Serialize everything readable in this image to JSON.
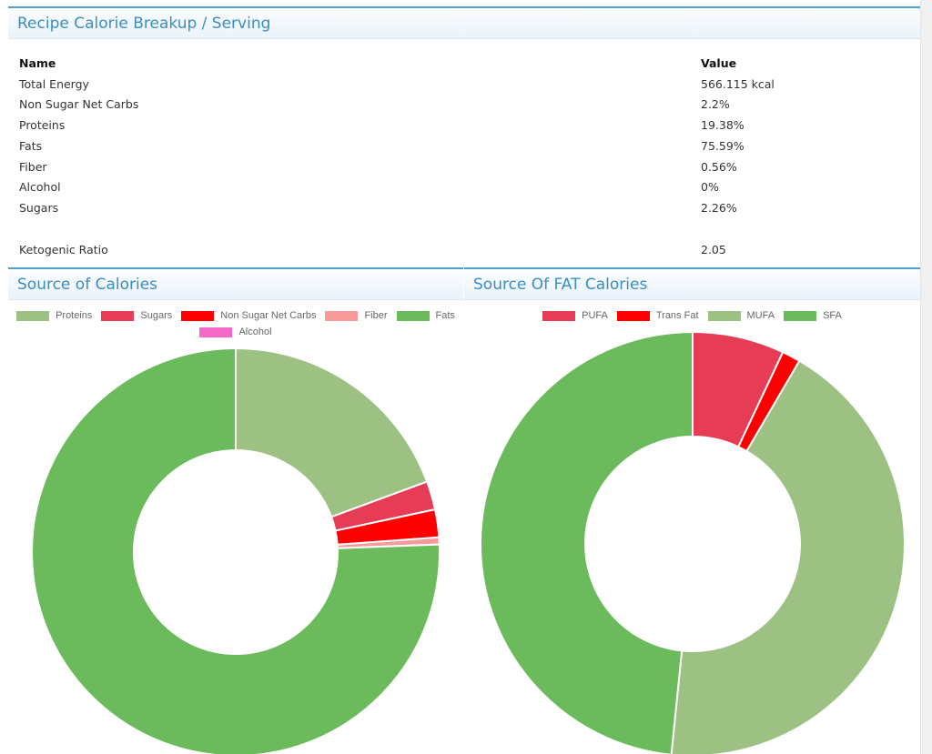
{
  "breakup": {
    "title": "Recipe Calorie Breakup / Serving",
    "columns": {
      "name": "Name",
      "value": "Value"
    },
    "rows": [
      {
        "name": "Total Energy",
        "value": "566.115 kcal"
      },
      {
        "name": "Non Sugar Net Carbs",
        "value": "2.2%"
      },
      {
        "name": "Proteins",
        "value": "19.38%"
      },
      {
        "name": "Fats",
        "value": "75.59%"
      },
      {
        "name": "Fiber",
        "value": "0.56%"
      },
      {
        "name": "Alcohol",
        "value": "0%"
      },
      {
        "name": "Sugars",
        "value": "2.26%"
      }
    ],
    "ketogenic": {
      "name": "Ketogenic Ratio",
      "value": "2.05"
    }
  },
  "chart_data": [
    {
      "type": "pie",
      "variant": "doughnut",
      "title": "Source of Calories",
      "legend_position": "top",
      "categories": [
        "Proteins",
        "Sugars",
        "Non Sugar Net Carbs",
        "Fiber",
        "Fats",
        "Alcohol"
      ],
      "values": [
        19.38,
        2.26,
        2.2,
        0.56,
        75.59,
        0
      ],
      "colors": [
        "#9dc183",
        "#e63c55",
        "#ff0000",
        "#f99a9a",
        "#6bbb5c",
        "#f569c8"
      ]
    },
    {
      "type": "pie",
      "variant": "doughnut",
      "title": "Source Of FAT Calories",
      "legend_position": "top",
      "categories": [
        "PUFA",
        "Trans Fat",
        "MUFA",
        "SFA"
      ],
      "values": [
        7.0,
        1.4,
        43.2,
        48.4
      ],
      "colors": [
        "#e63c55",
        "#ff0000",
        "#9dc183",
        "#6bbb5c"
      ]
    }
  ]
}
